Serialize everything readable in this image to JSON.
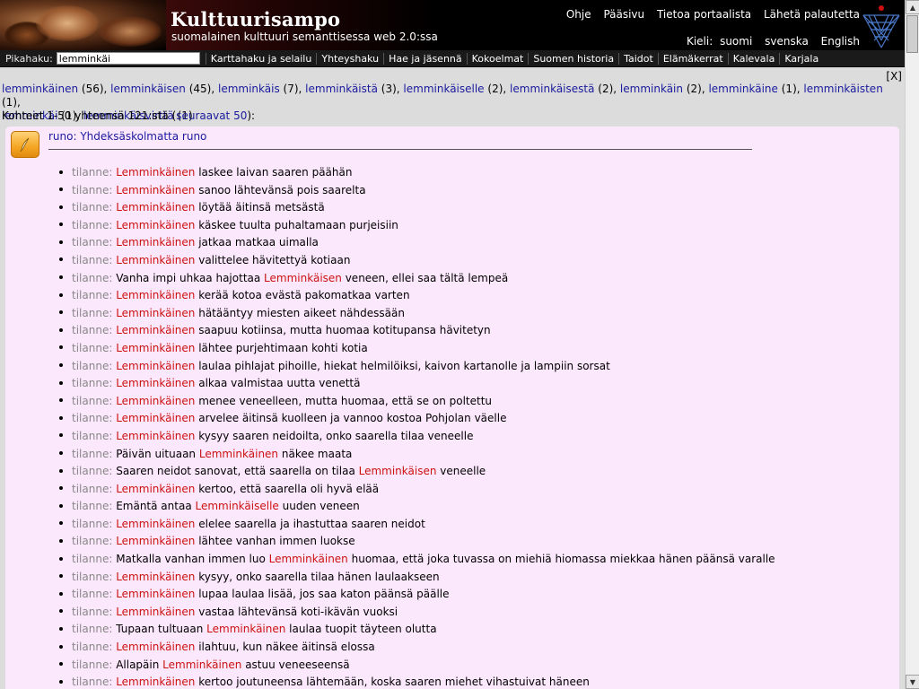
{
  "header": {
    "title": "Kulttuurisampo",
    "subtitle": "suomalainen kulttuuri semanttisessa web 2.0:ssa",
    "links": [
      "Ohje",
      "Pääsivu",
      "Tietoa portaalista",
      "Lähetä palautetta"
    ],
    "lang_label": "Kieli:",
    "languages": [
      "suomi",
      "svenska",
      "English"
    ]
  },
  "nav": {
    "search_label": "Pikahaku:",
    "search_value": "lemminkäi",
    "items": [
      "Karttahaku ja selailu",
      "Yhteyshaku",
      "Hae ja jäsennä",
      "Kokoelmat",
      "Suomen historia",
      "Taidot",
      "Elämäkerrat",
      "Kalevala",
      "Karjala"
    ]
  },
  "close_label": "[X]",
  "variants": [
    {
      "term": "lemminkäinen",
      "count": "(56),"
    },
    {
      "term": "lemminkäisen",
      "count": "(45),"
    },
    {
      "term": "lemminkäis",
      "count": "(7),"
    },
    {
      "term": "lemminkäistä",
      "count": "(3),"
    },
    {
      "term": "lemminkäiselle",
      "count": "(2),"
    },
    {
      "term": "lemminkäisestä",
      "count": "(2),"
    },
    {
      "term": "lemminkäin",
      "count": "(2),"
    },
    {
      "term": "lemminkäine",
      "count": "(1),"
    },
    {
      "term": "lemminkäisten",
      "count": "(1),"
    },
    {
      "term": "lemminkäi",
      "count": "(1),"
    },
    {
      "term": "lemminkäisvirttä",
      "count": "(1)"
    }
  ],
  "summary": {
    "text": "Kohteet 1-50 yhteensä 121:stä (",
    "link": "seuraavat 50",
    "end": "):"
  },
  "result": {
    "title": "runo: Yhdeksäskolmatta runo",
    "prefix": "tilanne:",
    "items": [
      {
        "before": "",
        "hl": "Lemminkäinen",
        "after": " laskee laivan saaren päähän"
      },
      {
        "before": "",
        "hl": "Lemminkäinen",
        "after": " sanoo lähtevänsä pois saarelta"
      },
      {
        "before": "",
        "hl": "Lemminkäinen",
        "after": " löytää äitinsä metsästä"
      },
      {
        "before": "",
        "hl": "Lemminkäinen",
        "after": " käskee tuulta puhaltamaan purjeisiin"
      },
      {
        "before": "",
        "hl": "Lemminkäinen",
        "after": " jatkaa matkaa uimalla"
      },
      {
        "before": "",
        "hl": "Lemminkäinen",
        "after": " valittelee hävitettyä kotiaan"
      },
      {
        "before": "Vanha impi uhkaa hajottaa ",
        "hl": "Lemminkäisen",
        "after": " veneen, ellei saa tältä lempeä"
      },
      {
        "before": "",
        "hl": "Lemminkäinen",
        "after": " kerää kotoa evästä pakomatkaa varten"
      },
      {
        "before": "",
        "hl": "Lemminkäinen",
        "after": " hätääntyy miesten aikeet nähdessään"
      },
      {
        "before": "",
        "hl": "Lemminkäinen",
        "after": " saapuu kotiinsa, mutta huomaa kotitupansa hävitetyn"
      },
      {
        "before": "",
        "hl": "Lemminkäinen",
        "after": " lähtee purjehtimaan kohti kotia"
      },
      {
        "before": "",
        "hl": "Lemminkäinen",
        "after": " laulaa pihlajat pihoille, hiekat helmilöiksi, kaivon kartanolle ja lampiin sorsat"
      },
      {
        "before": "",
        "hl": "Lemminkäinen",
        "after": " alkaa valmistaa uutta venettä"
      },
      {
        "before": "",
        "hl": "Lemminkäinen",
        "after": " menee veneelleen, mutta huomaa, että se on poltettu"
      },
      {
        "before": "",
        "hl": "Lemminkäinen",
        "after": " arvelee äitinsä kuolleen ja vannoo kostoa Pohjolan väelle"
      },
      {
        "before": "",
        "hl": "Lemminkäinen",
        "after": " kysyy saaren neidoilta, onko saarella tilaa veneelle"
      },
      {
        "before": "Päivän uituaan ",
        "hl": "Lemminkäinen",
        "after": " näkee maata"
      },
      {
        "before": "Saaren neidot sanovat, että saarella on tilaa ",
        "hl": "Lemminkäisen",
        "after": " veneelle"
      },
      {
        "before": "",
        "hl": "Lemminkäinen",
        "after": " kertoo, että saarella oli hyvä elää"
      },
      {
        "before": "Emäntä antaa ",
        "hl": "Lemminkäiselle",
        "after": " uuden veneen"
      },
      {
        "before": "",
        "hl": "Lemminkäinen",
        "after": " elelee saarella ja ihastuttaa saaren neidot"
      },
      {
        "before": "",
        "hl": "Lemminkäinen",
        "after": " lähtee vanhan immen luokse"
      },
      {
        "before": "Matkalla vanhan immen luo ",
        "hl": "Lemminkäinen",
        "after": " huomaa, että joka tuvassa on miehiä hiomassa miekkaa hänen päänsä varalle"
      },
      {
        "before": "",
        "hl": "Lemminkäinen",
        "after": " kysyy, onko saarella tilaa hänen laulaakseen"
      },
      {
        "before": "",
        "hl": "Lemminkäinen",
        "after": " lupaa laulaa lisää, jos saa katon päänsä päälle"
      },
      {
        "before": "",
        "hl": "Lemminkäinen",
        "after": " vastaa lähtevänsä koti-ikävän vuoksi"
      },
      {
        "before": "Tupaan tultuaan ",
        "hl": "Lemminkäinen",
        "after": " laulaa tuopit täyteen olutta"
      },
      {
        "before": "",
        "hl": "Lemminkäinen",
        "after": " ilahtuu, kun näkee äitinsä elossa"
      },
      {
        "before": "Allapäin ",
        "hl": "Lemminkäinen",
        "after": " astuu veneeseensä"
      },
      {
        "before": "",
        "hl": "Lemminkäinen",
        "after": " kertoo joutuneensa lähtemään, koska saaren miehet vihastuivat häneen"
      }
    ]
  }
}
